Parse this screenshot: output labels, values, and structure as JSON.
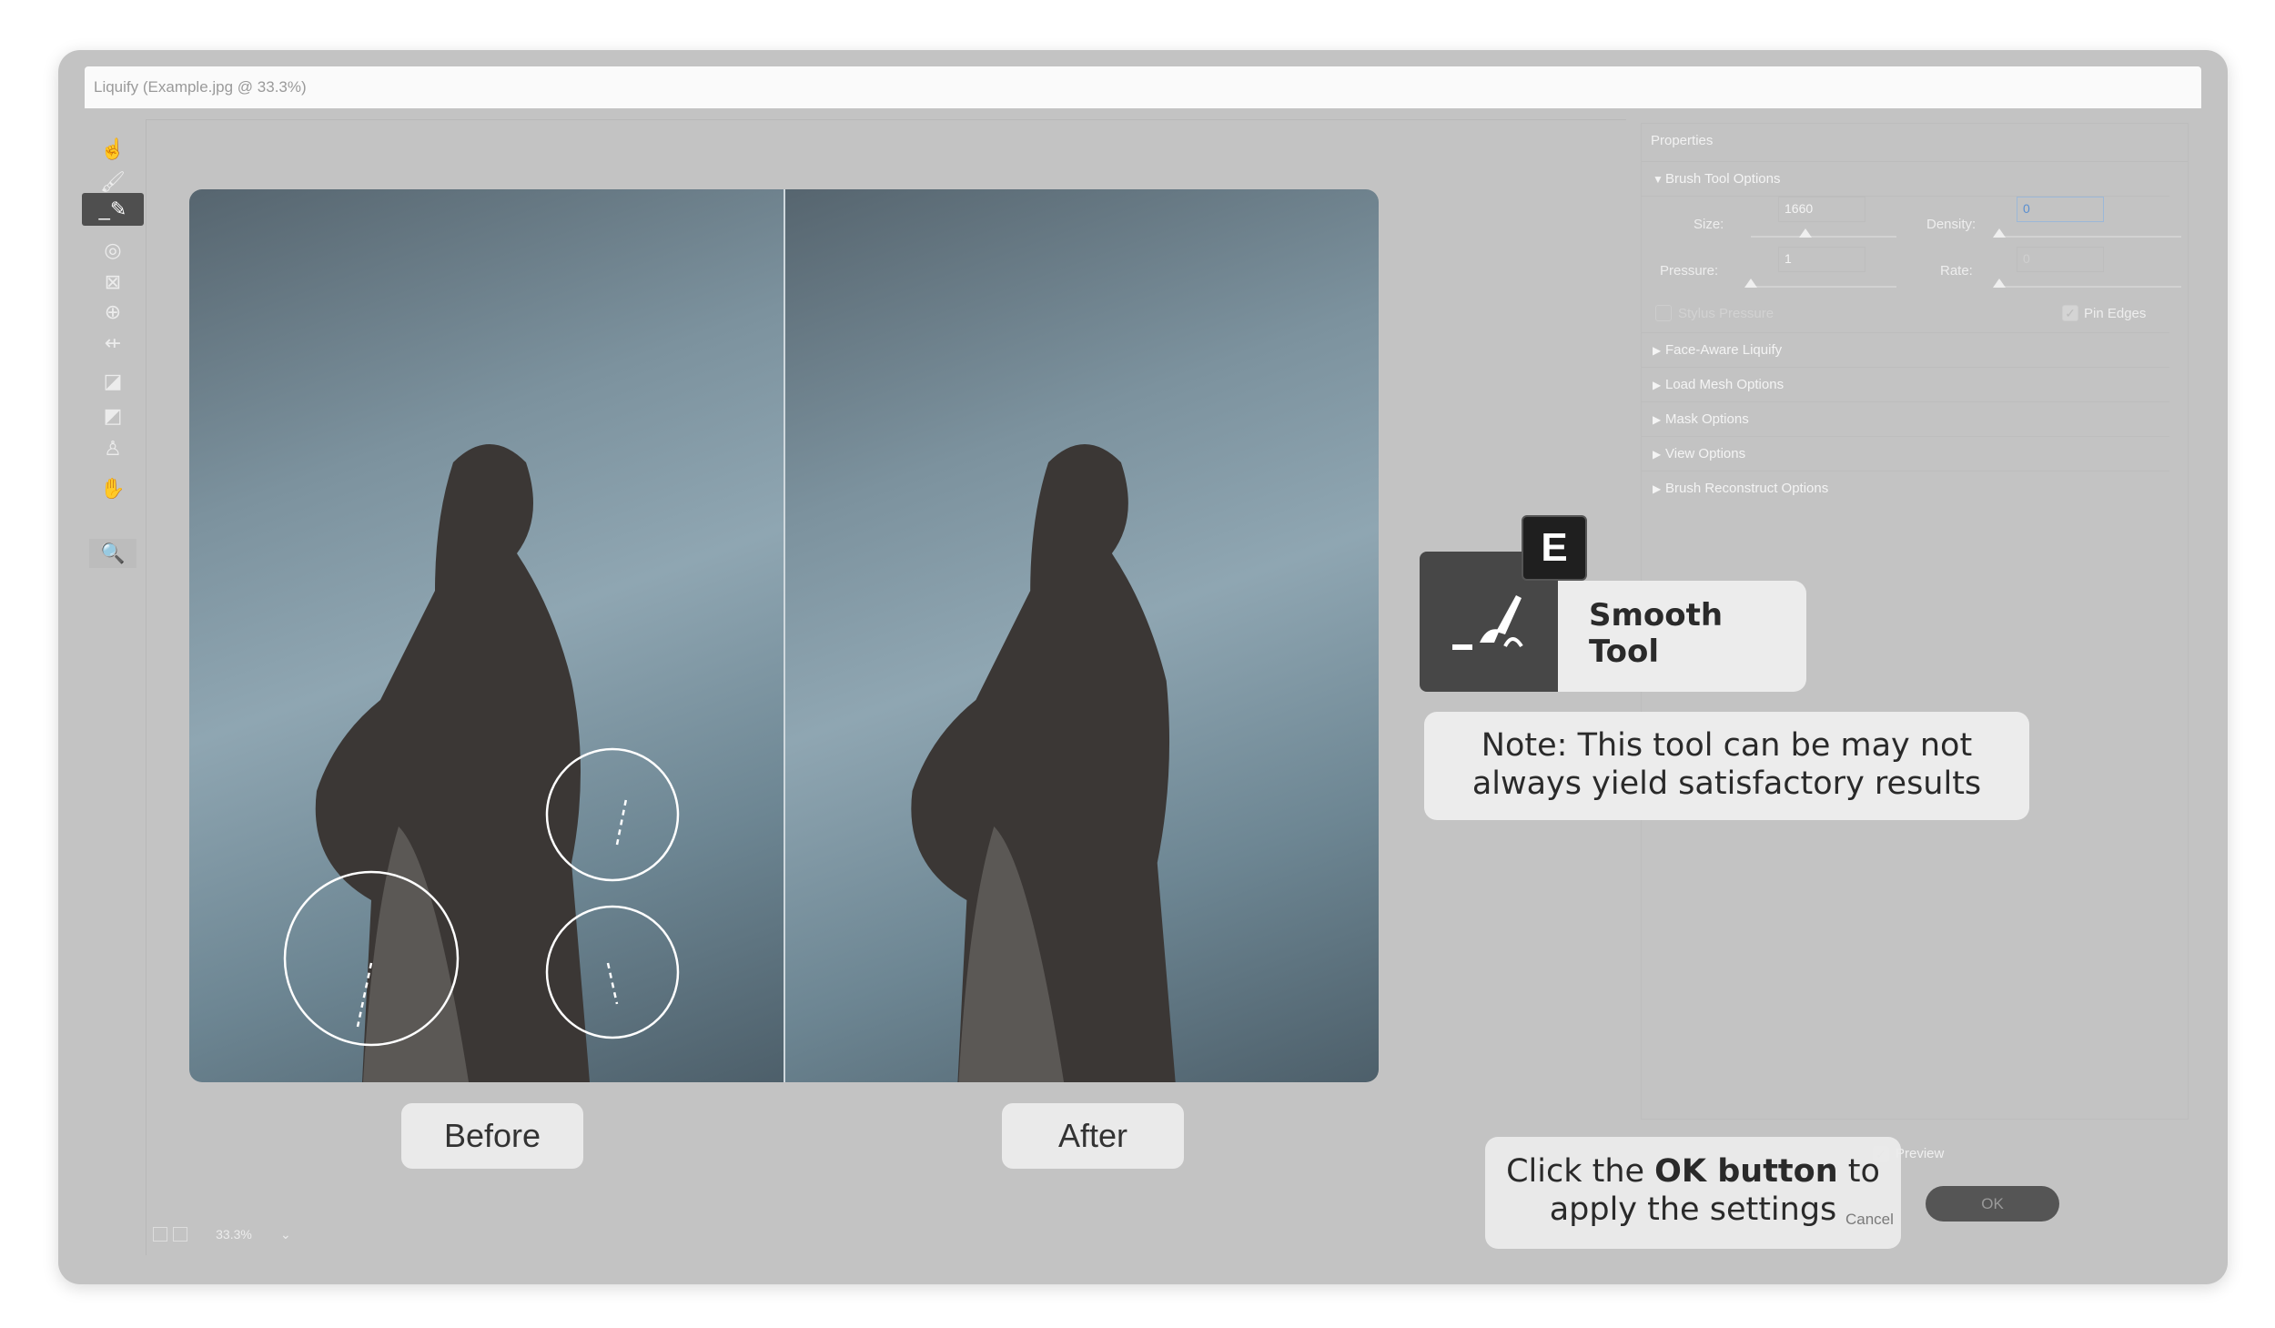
{
  "window": {
    "title": "Liquify (Example.jpg @ 33.3%)"
  },
  "toolbar": {
    "tools": [
      {
        "name": "forward-warp-tool",
        "icon": "finger-warp-icon"
      },
      {
        "name": "reconstruct-tool",
        "icon": "brush-sparkle-icon"
      },
      {
        "name": "smooth-tool",
        "icon": "smooth-brush-icon",
        "active": true
      },
      {
        "name": "twirl-tool",
        "icon": "twirl-icon"
      },
      {
        "name": "pucker-tool",
        "icon": "pucker-icon"
      },
      {
        "name": "bloat-tool",
        "icon": "bloat-icon"
      },
      {
        "name": "push-left-tool",
        "icon": "push-left-icon"
      },
      {
        "name": "freeze-mask-tool",
        "icon": "freeze-mask-icon"
      },
      {
        "name": "thaw-mask-tool",
        "icon": "thaw-mask-icon"
      },
      {
        "name": "face-tool",
        "icon": "face-icon"
      },
      {
        "name": "hand-tool",
        "icon": "hand-icon"
      },
      {
        "name": "zoom-tool",
        "icon": "zoom-icon"
      }
    ]
  },
  "canvas": {
    "before_label": "Before",
    "after_label": "After",
    "zoom": "33.3%"
  },
  "properties": {
    "title": "Properties",
    "brush_tool_options": {
      "label": "Brush Tool Options",
      "size_label": "Size:",
      "size": "1660",
      "size_fraction": 0.3,
      "density_label": "Density:",
      "density": "0",
      "density_fraction": 0,
      "pressure_label": "Pressure:",
      "pressure": "1",
      "pressure_fraction": 0,
      "rate_label": "Rate:",
      "rate": "0",
      "rate_fraction": 0,
      "stylus_pressure": "Stylus Pressure",
      "stylus_checked": false,
      "pin_edges": "Pin Edges",
      "pin_checked": true
    },
    "sections": [
      "Face-Aware Liquify",
      "Load Mesh Options",
      "Mask Options",
      "View Options",
      "Brush Reconstruct Options"
    ]
  },
  "footer": {
    "preview": "Preview",
    "preview_checked": true,
    "cancel": "Cancel",
    "ok": "OK"
  },
  "callouts": {
    "shortcut": "E",
    "tool_name_line1": "Smooth",
    "tool_name_line2": "Tool",
    "note_line1": "Note: This tool can be may not",
    "note_line2": "always yield satisfactory results",
    "ok_pre": "Click the ",
    "ok_bold": "OK button",
    "ok_post": " to",
    "ok_line2": "apply the settings"
  }
}
